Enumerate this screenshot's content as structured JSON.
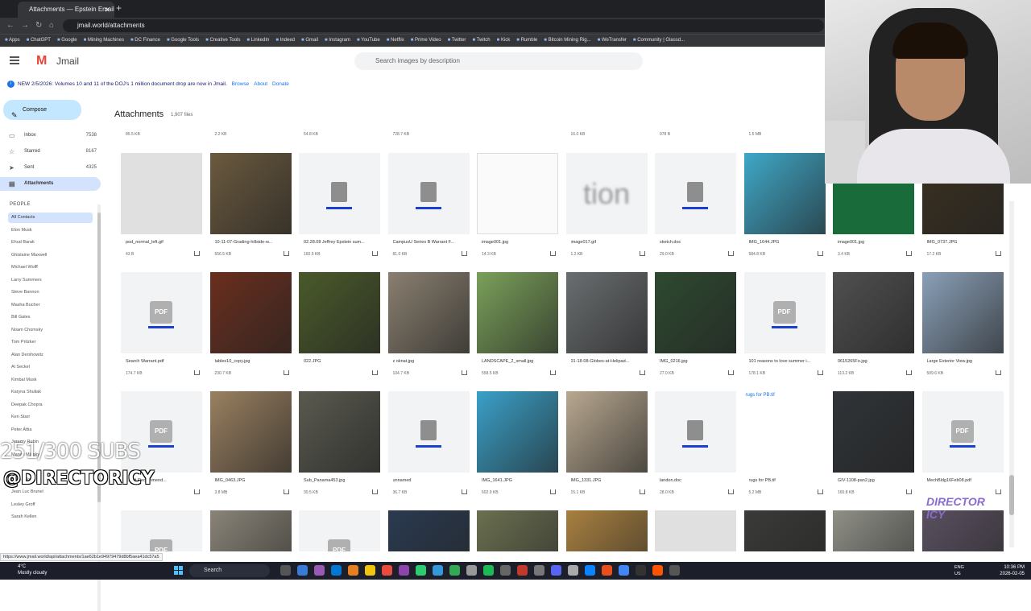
{
  "browser": {
    "tab_title": "Attachments — Epstein Emails",
    "url": "jmail.world/attachments",
    "bookmarks": [
      "Apps",
      "ChatGPT",
      "Google",
      "Mining Machines",
      "DC Finance",
      "Google Tools",
      "Creative Tools",
      "LinkedIn",
      "Indeed",
      "Gmail",
      "Instagram",
      "YouTube",
      "Netflix",
      "Prime Video",
      "Twitter",
      "Twitch",
      "Kick",
      "Rumble",
      "Bitcoin Mining Rig...",
      "WeTransfer",
      "Community | Glassd..."
    ],
    "status_url": "https://www.jmail.world/api/attachments/1ae62b1e94979479d8bf5aea41dc57a5"
  },
  "app": {
    "logo_text": "Jmail",
    "search_placeholder": "Search images by description",
    "banner": {
      "text": "NEW 2/5/2026: Volumes 10 and 11 of the DOJ's 1 million document drop are now in Jmail.",
      "browse": "Browse",
      "about": "About",
      "donate": "Donate"
    }
  },
  "sidebar": {
    "compose": "Compose",
    "folders": [
      {
        "label": "Inbox",
        "count": "7538"
      },
      {
        "label": "Starred",
        "count": "8167"
      },
      {
        "label": "Sent",
        "count": "4325"
      },
      {
        "label": "Attachments",
        "count": ""
      }
    ],
    "people_header": "PEOPLE",
    "contacts": [
      "All Contacts",
      "Elon Musk",
      "Ehud Barak",
      "Ghislaine Maxwell",
      "Michael Wolff",
      "Larry Summers",
      "Steve Bannon",
      "Masha Bucher",
      "Bill Gates",
      "Noam Chomsky",
      "Tom Pritzker",
      "Alan Dershowitz",
      "Al Seckel",
      "Kimbal Musk",
      "Karyna Shuliak",
      "Deepak Chopra",
      "Ken Starr",
      "Peter Attia",
      "Jeremy Rubin",
      "Marvin Minsky",
      "",
      "Boris Nikolic",
      "Jean Luc Brunel",
      "Lesley Groff",
      "Sarah Kellen"
    ]
  },
  "main": {
    "title": "Attachments",
    "count": "1,907 files",
    "top_sizes": [
      "85.5 KB",
      "2.2 KB",
      "54.8 KB",
      "728.7 KB",
      "",
      "16.0 KB",
      "978 B",
      "1.5 MB"
    ],
    "rows": [
      [
        {
          "name": "pod_normal_left.gif",
          "size": "43 B",
          "type": "blank"
        },
        {
          "name": "10-11-07-Grading-hillside-w...",
          "size": "556.5 KB",
          "type": "image",
          "color": "#6b5a3e"
        },
        {
          "name": "02.28.08 Jeffrey Epstein sum...",
          "size": "160.5 KB",
          "type": "doc"
        },
        {
          "name": "CampusU Series B Warrant F...",
          "size": "81.0 KB",
          "type": "doc"
        },
        {
          "name": "image001.jpg",
          "size": "14.3 KB",
          "type": "paper"
        },
        {
          "name": "image017.gif",
          "size": "1.2 KB",
          "type": "text",
          "text": "tion"
        },
        {
          "name": "sketch.doc",
          "size": "29.0 KB",
          "type": "doc"
        },
        {
          "name": "IMG_1644.JPG",
          "size": "584.8 KB",
          "type": "image",
          "color": "#3fa8c8"
        },
        {
          "name": "image001.jpg",
          "size": "3.4 KB",
          "type": "logo"
        },
        {
          "name": "IMG_0737.JPG",
          "size": "17.2 KB",
          "type": "image",
          "color": "#3a3020"
        }
      ],
      [
        {
          "name": "Search Warrant.pdf",
          "size": "174.7 KB",
          "type": "pdf"
        },
        {
          "name": "tables10_copy.jpg",
          "size": "230.7 KB",
          "type": "image",
          "color": "#6a2e1e"
        },
        {
          "name": "022.JPG",
          "size": "",
          "type": "image",
          "color": "#4a5a2a"
        },
        {
          "name": "z oknat.jpg",
          "size": "104.7 KB",
          "type": "image",
          "color": "#8a8070"
        },
        {
          "name": "LANDSCAPE_2_small.jpg",
          "size": "558.5 KB",
          "type": "image",
          "color": "#7aa05a"
        },
        {
          "name": "01-18-08-Globes-at-Helipad...",
          "size": "",
          "type": "image",
          "color": "#6a6e70"
        },
        {
          "name": "IMG_0216.jpg",
          "size": "27.0 KB",
          "type": "image",
          "color": "#2e4a30"
        },
        {
          "name": "101 reasons to love summer i...",
          "size": "178.1 KB",
          "type": "pdf"
        },
        {
          "name": "0615265Fo.jpg",
          "size": "113.2 KB",
          "type": "image",
          "color": "#505050"
        },
        {
          "name": "Large Exterior View.jpg",
          "size": "509.6 KB",
          "type": "image",
          "color": "#8aa0b8"
        }
      ],
      [
        {
          "name": "...edit Recommend...",
          "size": "",
          "type": "pdf"
        },
        {
          "name": "IMG_0463.JPG",
          "size": "3.8 MB",
          "type": "image",
          "color": "#9a8060"
        },
        {
          "name": "Sub_Panama453.jpg",
          "size": "30.5 KB",
          "type": "image",
          "color": "#5a5a50"
        },
        {
          "name": "unnamed",
          "size": "36.7 KB",
          "type": "doc"
        },
        {
          "name": "IMG_1641.JPG",
          "size": "602.9 KB",
          "type": "image",
          "color": "#3aa0c8"
        },
        {
          "name": "IMG_1331.JPG",
          "size": "15.1 KB",
          "type": "image",
          "color": "#b8a890"
        },
        {
          "name": "landon.doc",
          "size": "28.0 KB",
          "type": "doc"
        },
        {
          "name": "rugs for PB.tif",
          "size": "5.2 MB",
          "type": "broken",
          "alt": "rugs for PB.tif"
        },
        {
          "name": "GIV-1108-pan2.jpg",
          "size": "165.8 KB",
          "type": "image",
          "color": "#303438"
        },
        {
          "name": "MechBldg16Feb08.pdf",
          "size": "",
          "type": "pdf"
        }
      ],
      [
        {
          "name": "",
          "size": "",
          "type": "pdf"
        },
        {
          "name": "",
          "size": "",
          "type": "image",
          "color": "#8a8478"
        },
        {
          "name": "",
          "size": "",
          "type": "pdf"
        },
        {
          "name": "",
          "size": "",
          "type": "image",
          "color": "#2a3a50"
        },
        {
          "name": "",
          "size": "",
          "type": "image",
          "color": "#6a7050"
        },
        {
          "name": "",
          "size": "",
          "type": "image",
          "color": "#a88040"
        },
        {
          "name": "",
          "size": "",
          "type": "blank"
        },
        {
          "name": "",
          "size": "",
          "type": "image",
          "color": "#3a3a38"
        },
        {
          "name": "",
          "size": "",
          "type": "image",
          "color": "#909088"
        },
        {
          "name": "",
          "size": "",
          "type": "image",
          "color": "#5a5060"
        }
      ]
    ]
  },
  "overlay": {
    "subs": "251/300 SUBS",
    "handle": "@DIRECTORICY",
    "corner_logo": "DIRECTOR ICY"
  },
  "taskbar": {
    "weather_temp": "4°C",
    "weather_desc": "Mostly cloudy",
    "search": "Search",
    "lang1": "ENG",
    "lang2": "US",
    "time": "10:36 PM",
    "date": "2026-02-05"
  }
}
